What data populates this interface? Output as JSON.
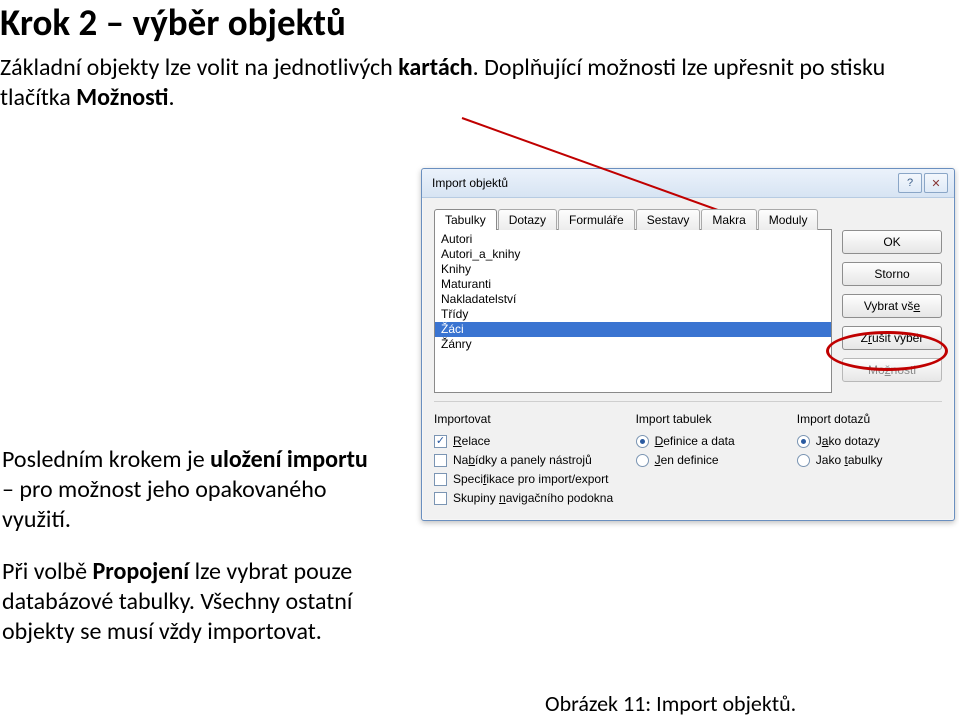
{
  "heading": "Krok 2 – výběr objektů",
  "intro": {
    "p1a": "Základní objekty lze volit na jednotlivých ",
    "p1b": "kartách",
    "p1c": ". Doplňující možnosti lze upřesnit po stisku tlačítka ",
    "p1d": "Možnosti",
    "p1e": "."
  },
  "left": {
    "p1a": "Posledním krokem je ",
    "p1b": "uložení importu",
    "p1c": " – pro možnost jeho opakovaného využití.",
    "p2a": "Při volbě ",
    "p2b": "Propojení",
    "p2c": " lze vybrat pouze databázové tabulky. Všechny ostatní objekty se musí vždy importovat."
  },
  "dialog": {
    "title": "Import objektů",
    "tabs": [
      "Tabulky",
      "Dotazy",
      "Formuláře",
      "Sestavy",
      "Makra",
      "Moduly"
    ],
    "list": [
      "Autori",
      "Autori_a_knihy",
      "Knihy",
      "Maturanti",
      "Nakladatelství",
      "Třídy",
      "Žáci",
      "Žánry"
    ],
    "selected_index": 6,
    "buttons": {
      "ok": "OK",
      "storno": "Storno",
      "vybrat_pre": "Vybrat vš",
      "vybrat_und": "e",
      "zrusit_pre": "Z",
      "zrusit_und": "r",
      "zrusit_post": "ušit výběr",
      "moznosti_pre": "Mo",
      "moznosti_und": "ž",
      "moznosti_post": "nosti"
    },
    "opts": {
      "col1_head": "Importovat",
      "col1": {
        "r1_und": "R",
        "r1_post": "elace",
        "r2_pre": "Na",
        "r2_und": "b",
        "r2_post": "ídky a panely nástrojů",
        "r3_pre": "Speci",
        "r3_und": "f",
        "r3_post": "ikace pro import/export",
        "r4_pre": "Skupiny ",
        "r4_und": "n",
        "r4_post": "avigačního podokna"
      },
      "col2_head": "Import tabulek",
      "col2": {
        "r1_und": "D",
        "r1_post": "efinice a data",
        "r2_pre": "",
        "r2_und": "J",
        "r2_post": "en definice"
      },
      "col3_head": "Import dotazů",
      "col3": {
        "r1_pre": "J",
        "r1_und": "a",
        "r1_post": "ko dotazy",
        "r2_pre": "Jako ",
        "r2_und": "t",
        "r2_post": "abulky"
      }
    }
  },
  "caption": "Obrázek 11: Import objektů."
}
